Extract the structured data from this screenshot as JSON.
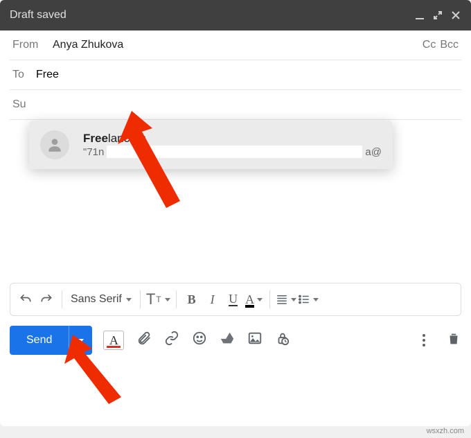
{
  "titlebar": {
    "text": "Draft saved"
  },
  "from": {
    "label": "From",
    "value": "Anya Zhukova"
  },
  "ccbcc": {
    "cc": "Cc",
    "bcc": "Bcc"
  },
  "to": {
    "label": "To",
    "input_value": "Free"
  },
  "subject": {
    "label": "Su"
  },
  "autocomplete": {
    "match_prefix": "Free",
    "match_rest": "lancers",
    "sub_prefix": "\"71n",
    "sub_suffix": "a@"
  },
  "format": {
    "font_name": "Sans Serif",
    "size_letter_big": "T",
    "size_letter_small": "T",
    "bold": "B",
    "italic": "I",
    "underline": "U",
    "color": "A"
  },
  "send": {
    "label": "Send"
  },
  "attribution": "wsxzh.com"
}
